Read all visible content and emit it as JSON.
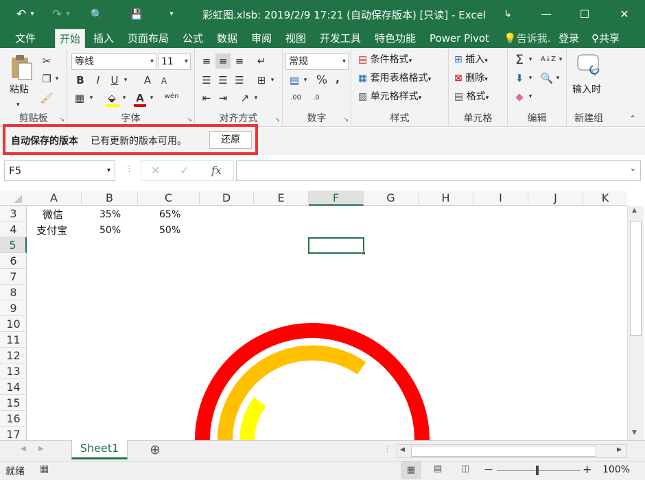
{
  "window": {
    "title": "彩虹图.xlsb: 2019/2/9 17:21 (自动保存版本) [只读] - Excel",
    "restore_icon": "↳",
    "minimize_icon": "—",
    "maximize_icon": "☐",
    "close_icon": "✕"
  },
  "quick_access": {
    "undo": "↶",
    "redo": "↷",
    "preview": "🔍",
    "save": "💾",
    "customize": "▾"
  },
  "tabs": [
    {
      "label": "文件"
    },
    {
      "label": "开始"
    },
    {
      "label": "插入"
    },
    {
      "label": "页面布局"
    },
    {
      "label": "公式"
    },
    {
      "label": "数据"
    },
    {
      "label": "审阅"
    },
    {
      "label": "视图"
    },
    {
      "label": "开发工具"
    },
    {
      "label": "特色功能"
    },
    {
      "label": "Power Pivot"
    }
  ],
  "tell_me": "告诉我.",
  "login": "登录",
  "share": "共享",
  "ribbon": {
    "clipboard": {
      "label": "剪贴板",
      "paste": "粘贴"
    },
    "font": {
      "label": "字体",
      "font_name": "等线",
      "font_size": "11",
      "bold": "B",
      "italic": "I",
      "underline": "U",
      "grow": "A",
      "shrink": "A",
      "wen": "wén"
    },
    "align": {
      "label": "对齐方式"
    },
    "number": {
      "label": "数字",
      "format": "常规",
      "percent": "%",
      "comma": ",",
      "inc": ".00",
      "dec": ".0"
    },
    "styles": {
      "label": "样式",
      "conditional": "条件格式",
      "table": "套用表格格式",
      "cell": "单元格样式"
    },
    "cells": {
      "label": "单元格",
      "insert": "插入",
      "delete": "删除",
      "format": "格式"
    },
    "editing": {
      "label": "编辑",
      "sum": "Σ",
      "sort": "A↓Z"
    },
    "newgroup": {
      "label": "新建组",
      "input_time": "输入时"
    }
  },
  "infobar": {
    "title": "自动保存的版本",
    "message": "已有更新的版本可用。",
    "restore": "还原"
  },
  "formula_bar": {
    "name_box": "F5",
    "cancel": "✕",
    "enter": "✓",
    "fx": "fx",
    "formula": ""
  },
  "columns": [
    "A",
    "B",
    "C",
    "D",
    "E",
    "F",
    "G",
    "H",
    "I",
    "J",
    "K"
  ],
  "rows": [
    "3",
    "4",
    "5",
    "6",
    "7",
    "8",
    "9",
    "10",
    "11",
    "12",
    "13",
    "14",
    "15",
    "16",
    "17"
  ],
  "cells": [
    {
      "a": "微信",
      "b": "35%",
      "c": "65%"
    },
    {
      "a": "支付宝",
      "b": "50%",
      "c": "50%"
    }
  ],
  "sheet": {
    "name": "Sheet1",
    "add": "⊕"
  },
  "status": {
    "ready": "就绪",
    "zoom": "100%",
    "minus": "—",
    "plus": "+"
  },
  "chart_colors": {
    "outer": "#ff0000",
    "middle": "#ffc000",
    "inner": "#ffff00"
  }
}
